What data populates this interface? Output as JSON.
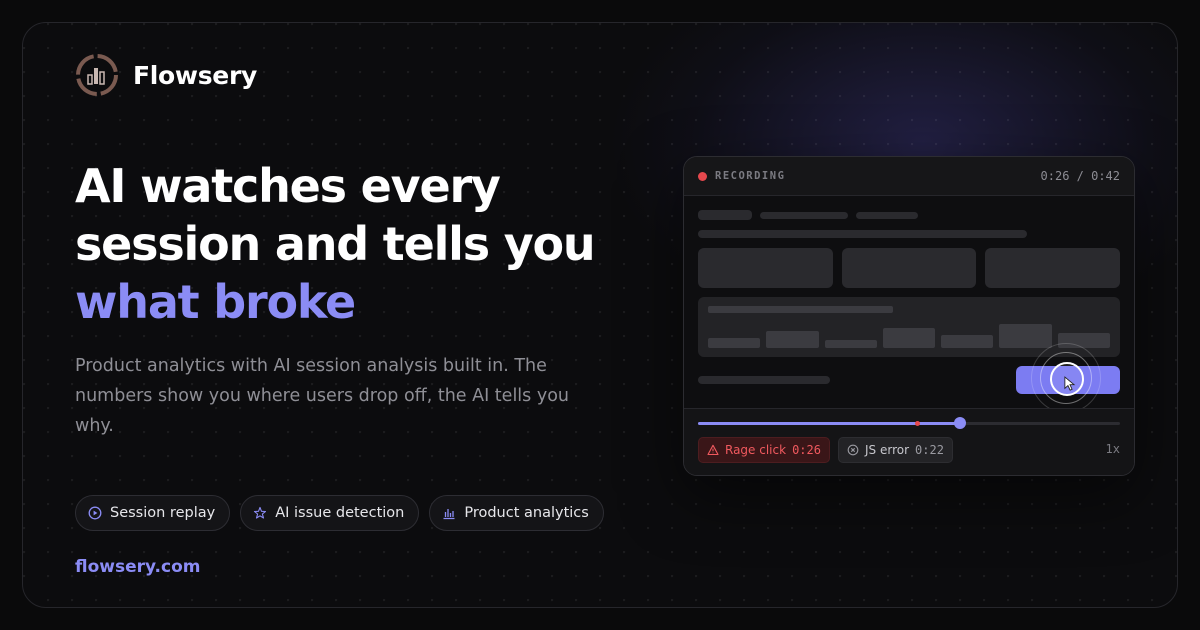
{
  "brand": {
    "name": "Flowsery",
    "icon": "flowsery-logo"
  },
  "headline": {
    "line1": "AI watches every",
    "line2": "session and tells you",
    "accent": "what broke"
  },
  "subheadline": "Product analytics with AI session analysis built in. The numbers show you where users drop off, the AI tells you why.",
  "features": [
    {
      "label": "Session replay",
      "icon": "play-circle-icon"
    },
    {
      "label": "AI issue detection",
      "icon": "sparkle-star-icon"
    },
    {
      "label": "Product analytics",
      "icon": "bar-chart-icon"
    }
  ],
  "website": "flowsery.com",
  "player": {
    "status": "RECORDING",
    "time": "0:26 / 0:42",
    "progress": 0.62,
    "event_marker": 0.52,
    "events": [
      {
        "label": "Rage click",
        "time": "0:26",
        "icon": "warning-triangle-icon"
      },
      {
        "label": "JS error",
        "time": "0:22",
        "icon": "x-circle-icon"
      }
    ],
    "speed": "1x"
  },
  "colors": {
    "accent": "#8b8cf5",
    "error": "#e5484d",
    "background": "#0a0a0b"
  }
}
